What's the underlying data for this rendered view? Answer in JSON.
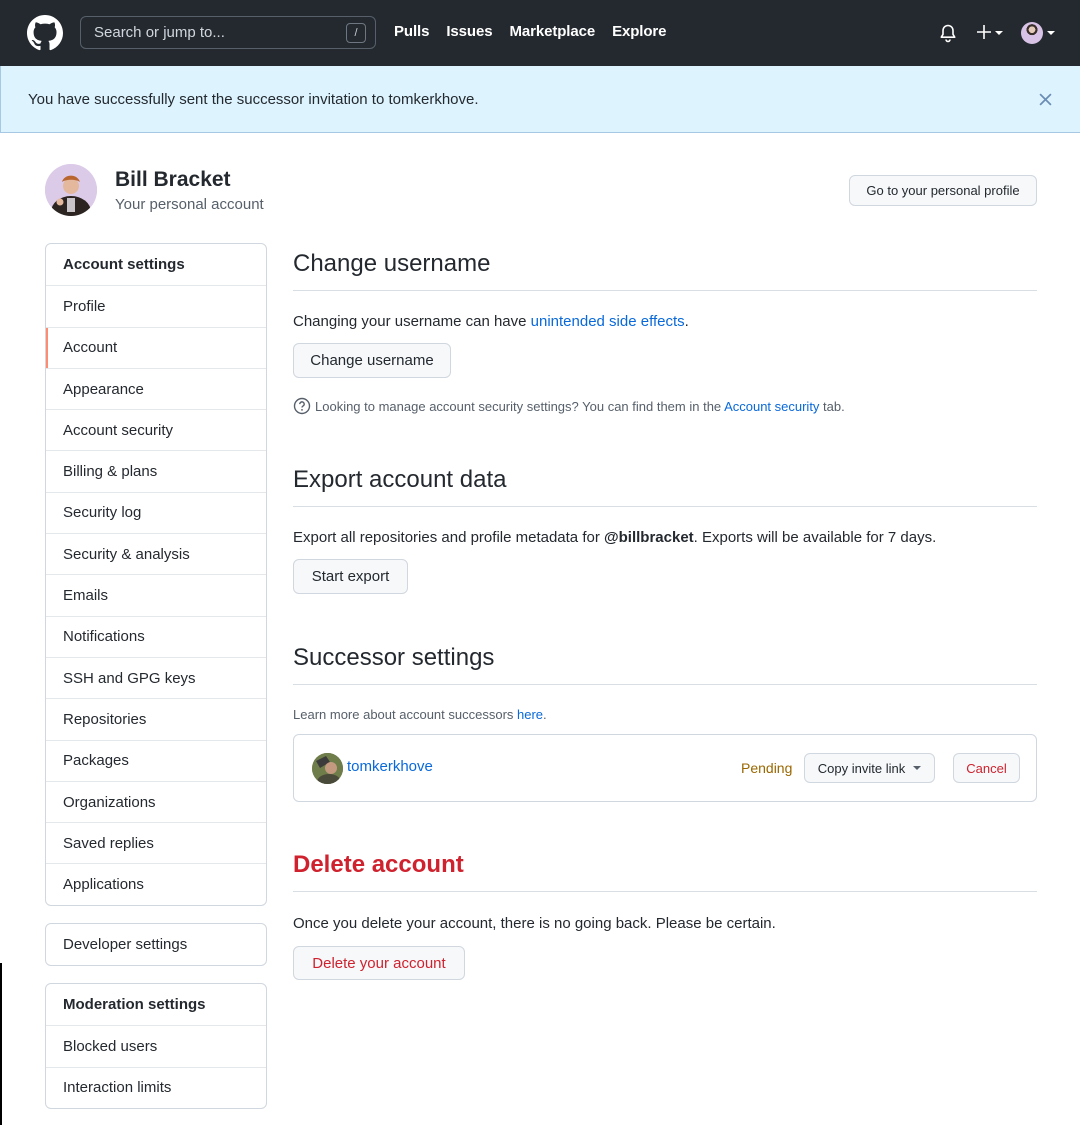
{
  "header": {
    "search_placeholder": "Search or jump to...",
    "search_shortcut": "/",
    "nav": [
      "Pulls",
      "Issues",
      "Marketplace",
      "Explore"
    ],
    "icons": [
      "github-logo-icon",
      "bell-icon",
      "plus-icon",
      "avatar"
    ]
  },
  "flash": {
    "message": "You have successfully sent the successor invitation to tomkerkhove."
  },
  "profile": {
    "name": "Bill Bracket",
    "subtitle": "Your personal account",
    "profile_button": "Go to your personal profile"
  },
  "sidebar": {
    "account_settings": {
      "heading": "Account settings",
      "selected": "Account",
      "items": [
        "Profile",
        "Account",
        "Appearance",
        "Account security",
        "Billing & plans",
        "Security log",
        "Security & analysis",
        "Emails",
        "Notifications",
        "SSH and GPG keys",
        "Repositories",
        "Packages",
        "Organizations",
        "Saved replies",
        "Applications"
      ]
    },
    "developer_settings": "Developer settings",
    "moderation_settings": {
      "heading": "Moderation settings",
      "items": [
        "Blocked users",
        "Interaction limits"
      ]
    }
  },
  "main": {
    "change_username": {
      "title": "Change username",
      "text_before": "Changing your username can have ",
      "link": "unintended side effects",
      "text_after": ".",
      "button": "Change username",
      "note_before": "Looking to manage account security settings? You can find them in the ",
      "note_link": "Account security",
      "note_after": " tab."
    },
    "export": {
      "title": "Export account data",
      "text_before": "Export all repositories and profile metadata for ",
      "handle": "@billbracket",
      "text_after": ". Exports will be available for 7 days.",
      "button": "Start export"
    },
    "successor": {
      "title": "Successor settings",
      "learn_before": "Learn more about account successors ",
      "learn_link": "here",
      "learn_after": ".",
      "username": "tomkerkhove",
      "status": "Pending",
      "copy_button": "Copy invite link",
      "cancel_button": "Cancel"
    },
    "delete": {
      "title": "Delete account",
      "text": "Once you delete your account, there is no going back. Please be certain.",
      "button": "Delete your account"
    }
  },
  "colors": {
    "header_bg": "#24292f",
    "flash_bg": "#ddf4ff",
    "link": "#0969da",
    "danger": "#cf222e",
    "pending": "#9a6700",
    "selected_indicator": "#fd8c73"
  }
}
